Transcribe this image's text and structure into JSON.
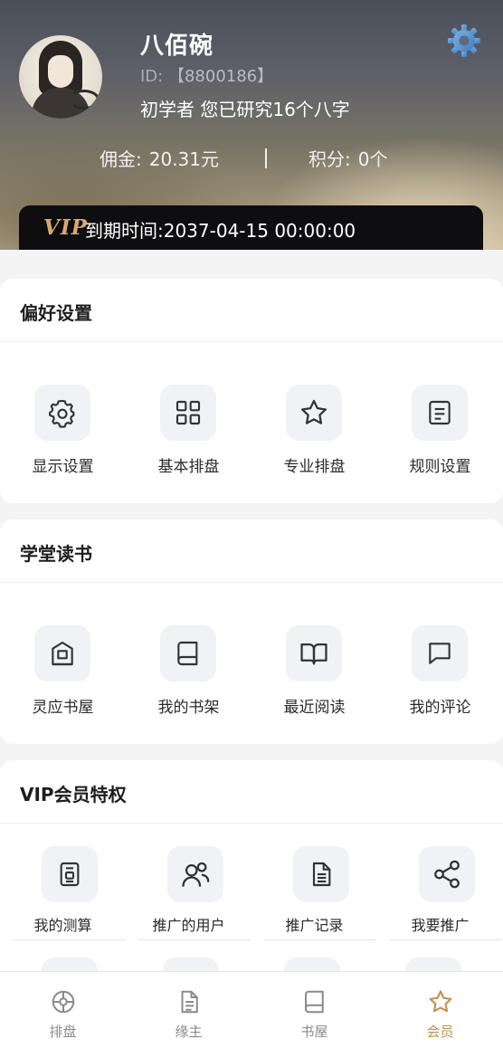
{
  "profile": {
    "name": "八佰碗",
    "id_label": "ID:",
    "id_value": "【8800186】",
    "level_text": "初学者 您已研究16个八字"
  },
  "stats": {
    "commission_label": "佣金:",
    "commission_value": "20.31元",
    "points_label": "积分:",
    "points_value": "0个"
  },
  "vip": {
    "logo": "VIP",
    "expiry_text": "到期时间:2037-04-15 00:00:00",
    "logo_color": "#d9a96b"
  },
  "preferences": {
    "title": "偏好设置",
    "items": [
      {
        "label": "显示设置",
        "icon": "gear-icon"
      },
      {
        "label": "基本排盘",
        "icon": "grid-icon"
      },
      {
        "label": "专业排盘",
        "icon": "star-icon"
      },
      {
        "label": "规则设置",
        "icon": "document-list-icon"
      }
    ]
  },
  "study": {
    "title": "学堂读书",
    "items": [
      {
        "label": "灵应书屋",
        "icon": "house-icon"
      },
      {
        "label": "我的书架",
        "icon": "book-icon"
      },
      {
        "label": "最近阅读",
        "icon": "open-book-icon"
      },
      {
        "label": "我的评论",
        "icon": "chat-icon"
      }
    ]
  },
  "vip_privileges": {
    "title": "VIP会员特权",
    "items": [
      {
        "label": "我的测算",
        "icon": "calculation-doc-icon"
      },
      {
        "label": "推广的用户",
        "icon": "users-icon"
      },
      {
        "label": "推广记录",
        "icon": "record-icon"
      },
      {
        "label": "我要推广",
        "icon": "share-icon"
      }
    ]
  },
  "bottom_nav": {
    "items": [
      {
        "label": "排盘",
        "icon": "compass-icon"
      },
      {
        "label": "缘主",
        "icon": "file-icon"
      },
      {
        "label": "书屋",
        "icon": "book-icon"
      },
      {
        "label": "会员",
        "icon": "star-icon",
        "active": true
      }
    ],
    "active_color": "#c0914f",
    "inactive_color": "#8a8a8a"
  }
}
